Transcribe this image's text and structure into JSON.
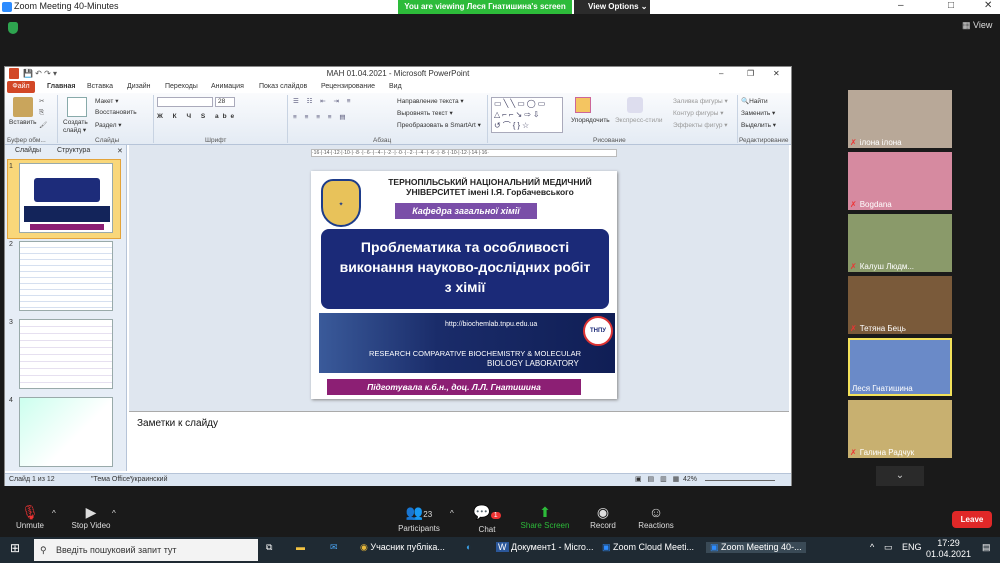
{
  "zoom": {
    "title": "Zoom Meeting 40-Minutes",
    "viewing": "You are viewing Леся Гнатишина's screen",
    "view_options": "View Options ⌄",
    "view": "View",
    "minimize": "–",
    "maximize": "□",
    "close": "✕",
    "leave": "Leave"
  },
  "ppt": {
    "title": "МАН 01.04.2021 - Microsoft PowerPoint",
    "tabs": [
      "Файл",
      "Главная",
      "Вставка",
      "Дизайн",
      "Переходы",
      "Анимация",
      "Показ слайдов",
      "Рецензирование",
      "Вид"
    ],
    "ribbon": {
      "paste": "Вставить",
      "layout": "Макет ▾",
      "reset": "Восстановить",
      "section": "Раздел ▾",
      "new_slide": "Создать слайд ▾",
      "groups": [
        "Буфер обм...",
        "Слайды",
        "Шрифт",
        "Абзац",
        "Рисование",
        "Редактирование"
      ],
      "font_size": "28",
      "text_dir": "Направление текста ▾",
      "align_text": "Выровнять текст ▾",
      "smartart": "Преобразовать в SmartArt ▾",
      "arrange": "Упорядочить",
      "quick_styles": "Экспресс-стили",
      "fill": "Заливка фигуры ▾",
      "outline": "Контур фигуры ▾",
      "effects": "Эффекты фигур ▾",
      "find": "Найти",
      "replace": "Заменить ▾",
      "select": "Выделить ▾"
    },
    "pane_tabs": [
      "Слайды",
      "Структура"
    ],
    "thumb_nums": [
      "1",
      "2",
      "3",
      "4"
    ],
    "ruler": "·16·|·14·|·12·|·10·|··8··|··6··|··4··|··2··|··0··|··2··|··4··|··6··|··8··|·10·|·12·|·14·|·16·",
    "slide": {
      "uni1": "ТЕРНОПІЛЬСЬКИЙ НАЦІОНАЛЬНИЙ МЕДИЧНИЙ",
      "uni2": "УНІВЕРСИТЕТ імені І.Я. Горбачевського",
      "dept": "Кафедра загальної хімії",
      "title": "Проблематика та особливості виконання науково-дослідних робіт з хімії",
      "url": "http://biochemlab.tnpu.edu.ua",
      "lab1": "RESEARCH COMPARATIVE BIOCHEMISTRY & MOLECULAR",
      "lab2": "BIOLOGY LABORATORY",
      "author": "Підготувала к.б.н., доц. Л.Л. Гнатишина",
      "logo_text": "ТНПУ"
    },
    "notes": "Заметки к слайду",
    "status": {
      "slide": "Слайд 1 из 12",
      "theme": "\"Тема Office\"",
      "lang": "украинский",
      "zoom": "42%"
    }
  },
  "participants": [
    {
      "name": "ілона ілона"
    },
    {
      "name": "Bogdana"
    },
    {
      "name": "Калуш Людм..."
    },
    {
      "name": "Тетяна Бець"
    },
    {
      "name": "Леся Гнатишина"
    },
    {
      "name": "Галина Радчук"
    }
  ],
  "bar": {
    "unmute": "Unmute",
    "stop_video": "Stop Video",
    "participants": "Participants",
    "participants_count": "23",
    "chat": "Chat",
    "chat_badge": "1",
    "share": "Share Screen",
    "record": "Record",
    "reactions": "Reactions"
  },
  "taskbar": {
    "search": "Введіть пошуковий запит тут",
    "items": [
      "Учасник публіка...",
      "Документ1 - Micro...",
      "Zoom Cloud Meeti...",
      "Zoom Meeting 40-..."
    ],
    "lang": "ENG",
    "time": "17:29",
    "date": "01.04.2021"
  }
}
